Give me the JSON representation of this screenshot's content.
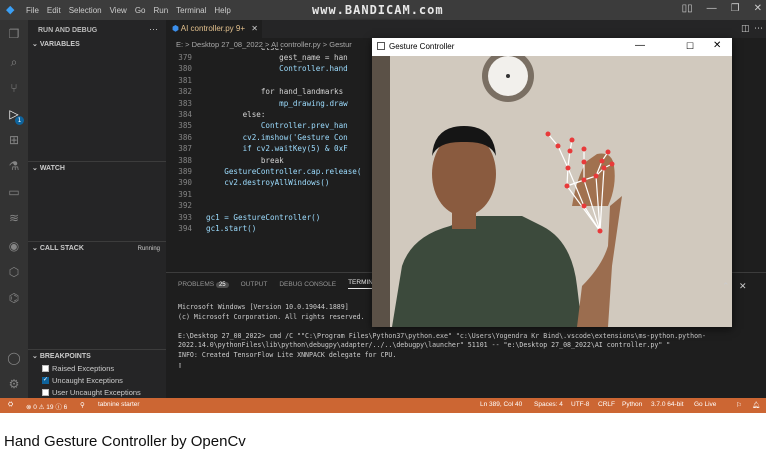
{
  "titlebar": {
    "menu": [
      "File",
      "Edit",
      "Selection",
      "View",
      "Go",
      "Run",
      "Terminal",
      "Help"
    ],
    "watermark": "www.BANDICAM.com"
  },
  "sidebar": {
    "title": "RUN AND DEBUG",
    "variables": "VARIABLES",
    "watch": "WATCH",
    "call_stack": "CALL STACK",
    "call_stack_status": "Running",
    "breakpoints": "BREAKPOINTS",
    "bp_items": [
      {
        "label": "Raised Exceptions",
        "checked": false
      },
      {
        "label": "Uncaught Exceptions",
        "checked": true
      },
      {
        "label": "User Uncaught Exceptions",
        "checked": false
      }
    ]
  },
  "activity_badge": "1",
  "editor": {
    "tab": "AI controller.py 9+",
    "breadcrumb": "E: > Desktop 27_08_2022 > AI controller.py > Gestur",
    "lines": [
      {
        "n": "379",
        "t": "                gest_name = han"
      },
      {
        "n": "380",
        "t": "                Controller.hand"
      },
      {
        "n": "381",
        "t": ""
      },
      {
        "n": "382",
        "t": "            for hand_landmarks "
      },
      {
        "n": "383",
        "t": "                mp_drawing.draw"
      },
      {
        "n": "384",
        "t": "        else:"
      },
      {
        "n": "385",
        "t": "            Controller.prev_han"
      },
      {
        "n": "386",
        "t": "        cv2.imshow('Gesture Con"
      },
      {
        "n": "387",
        "t": "        if cv2.waitKey(5) & 0xF"
      },
      {
        "n": "388",
        "t": "            break"
      },
      {
        "n": "389",
        "t": "    GestureController.cap.release("
      },
      {
        "n": "390",
        "t": "    cv2.destroyAllWindows()"
      },
      {
        "n": "391",
        "t": ""
      },
      {
        "n": "392",
        "t": ""
      },
      {
        "n": "393",
        "t": "gc1 = GestureController()"
      },
      {
        "n": "394",
        "t": "gc1.start()"
      }
    ],
    "top_partial": "            else:"
  },
  "panel": {
    "tabs": [
      "PROBLEMS",
      "OUTPUT",
      "DEBUG CONSOLE",
      "TERMINAL"
    ],
    "problems_count": "25",
    "terminal_lines": [
      "Microsoft Windows [Version 10.0.19044.1889]",
      "(c) Microsoft Corporation. All rights reserved.",
      "",
      "E:\\Desktop 27_08_2022> cmd /C \"\"C:\\Program Files\\Python37\\python.exe\" \"c:\\Users\\Yogendra Kr Bind\\.vscode\\extensions\\ms-python.python-",
      "2022.14.0\\pythonFiles\\lib\\python\\debugpy\\adapter/../..\\debugpy\\launcher\" 51101 -- \"e:\\Desktop 27_08_2022\\AI controller.py\" \"",
      "INFO: Created TensorFlow Lite XNNPACK delegate for CPU.",
      "▯"
    ]
  },
  "statusbar": {
    "left": "⊗ 0 ⚠ 19 ⓘ 6",
    "tabnine": "tabnine starter",
    "items": [
      "Ln 389, Col 40",
      "Spaces: 4",
      "UTF-8",
      "CRLF",
      "Python",
      "3.7.0 64-bit",
      "Go Live"
    ]
  },
  "gesture_window": {
    "title": "Gesture Controller"
  },
  "caption": "Hand Gesture Controller by OpenCv",
  "colors": {
    "statusbar": "#cc6633",
    "editor_bg": "#1e1e1e",
    "sidebar_bg": "#252526"
  }
}
